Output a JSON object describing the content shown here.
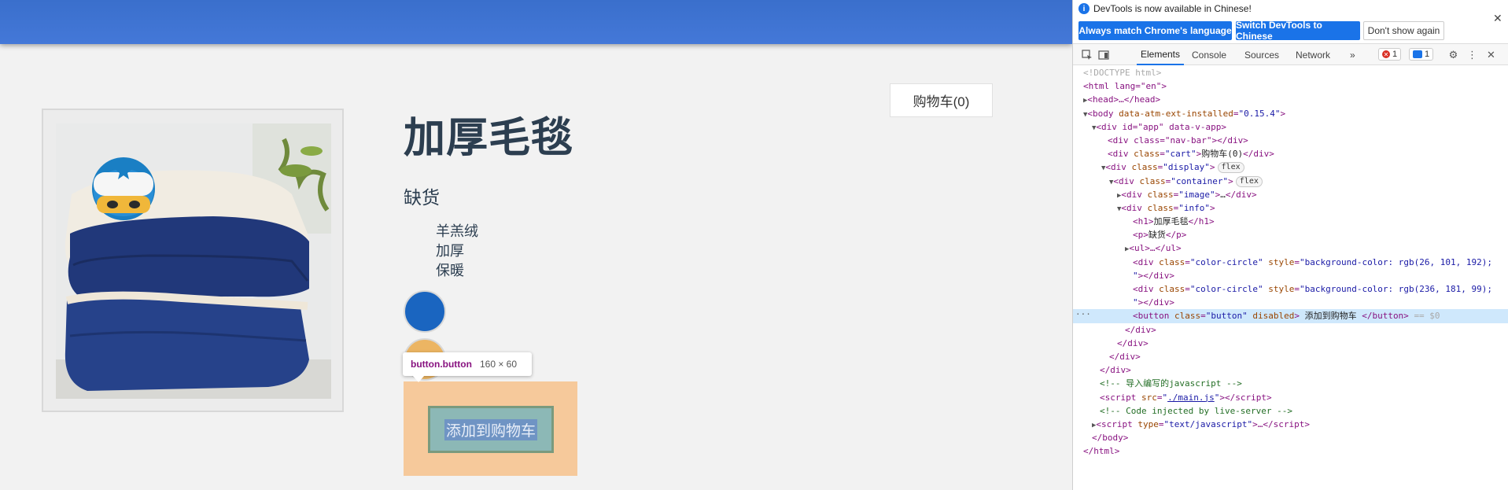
{
  "app": {
    "cart_label": "购物车(0)",
    "title": "加厚毛毯",
    "stock": "缺货",
    "features": [
      "羊羔绒",
      "加厚",
      "保暖"
    ],
    "colors": [
      "rgb(26, 101, 192)",
      "rgb(236, 181, 99)"
    ],
    "button_label": "添加到购物车",
    "tooltip": {
      "tag": "button.button",
      "size": "160 × 60"
    }
  },
  "devtools": {
    "infobar": {
      "message": "DevTools is now available in Chinese!",
      "btn_match": "Always match Chrome's language",
      "btn_switch": "Switch DevTools to Chinese",
      "btn_dismiss": "Don't show again"
    },
    "tabs": [
      "Elements",
      "Console",
      "Sources",
      "Network"
    ],
    "more_tabs": "»",
    "errors": "1",
    "messages": "1",
    "code": {
      "doctype": "<!DOCTYPE html>",
      "html_open": "<html lang=\"en\">",
      "head": "<head>…</head>",
      "body_attr": "data-atm-ext-installed",
      "body_val": "\"0.15.4\"",
      "app_div": "<div id=\"app\" data-v-app>",
      "navbar": "<div class=\"nav-bar\"></div>",
      "cart_text": "购物车(0)",
      "flex": "flex",
      "image": "…",
      "h1_text": "加厚毛毯",
      "p_text": "缺货",
      "style1": "background-color: rgb(26, 101, 192);",
      "style2": "background-color: rgb(236, 181, 99);",
      "button_text": " 添加到购物车 ",
      "eq": "== $0",
      "comment1": "<!-- 导入编写的javascript -->",
      "script_src": "./main.js",
      "comment2": "<!-- Code injected by live-server -->",
      "script_type": "\"text/javascript\""
    }
  }
}
